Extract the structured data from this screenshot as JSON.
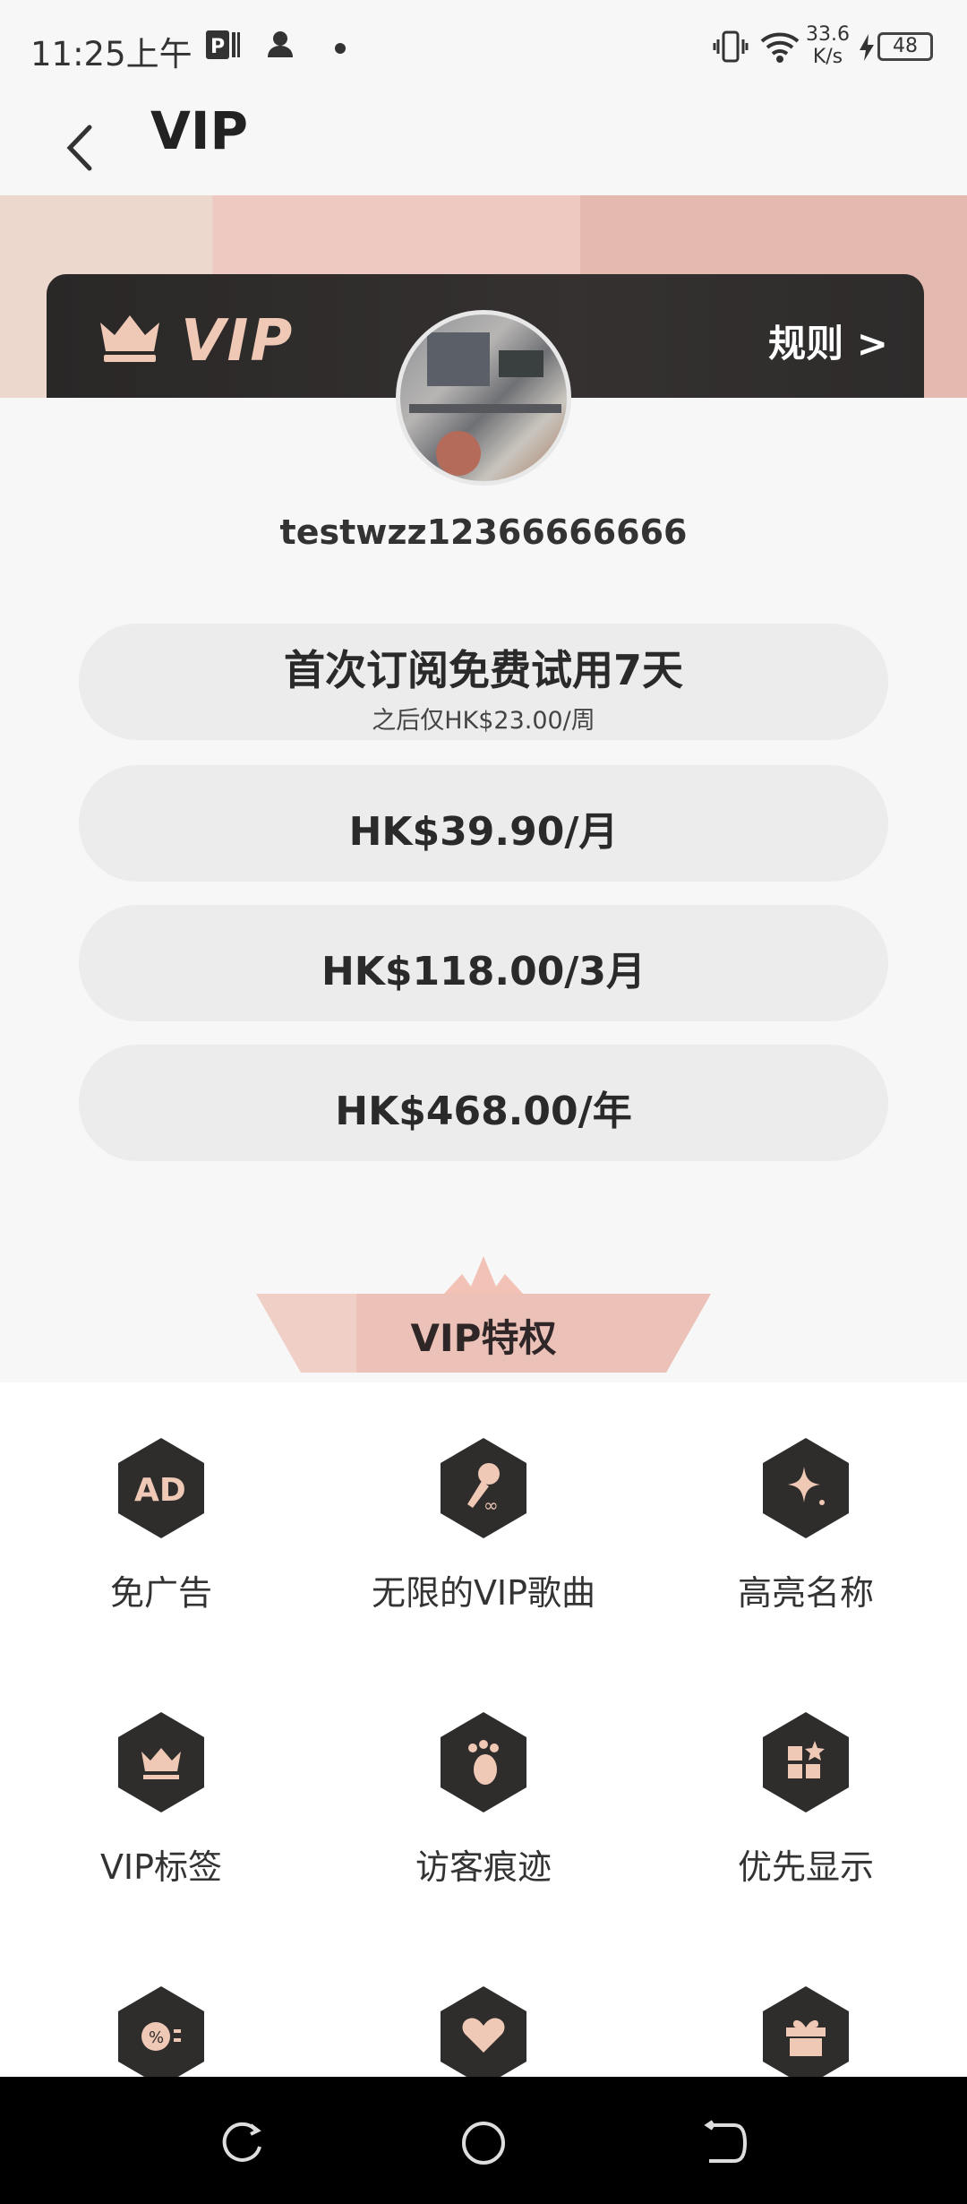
{
  "status_bar": {
    "time": "11:25上午",
    "net_speed_value": "33.6",
    "net_speed_unit": "K/s",
    "battery": "48"
  },
  "app_bar": {
    "title": "VIP"
  },
  "vip_banner": {
    "logo_text": "VIP",
    "rules_label": "规则 >"
  },
  "user": {
    "username": "testwzz12366666666"
  },
  "plans": [
    {
      "price": "首次订阅免费试用7天",
      "note": "之后仅HK$23.00/周"
    },
    {
      "price": "HK$39.90/月"
    },
    {
      "price": "HK$118.00/3月"
    },
    {
      "price": "HK$468.00/年"
    }
  ],
  "privileges": {
    "title": "VIP特权",
    "items": [
      {
        "label": "免广告",
        "icon": "ad-icon"
      },
      {
        "label": "无限的VIP歌曲",
        "icon": "microphone-icon"
      },
      {
        "label": "高亮名称",
        "icon": "sparkle-icon"
      },
      {
        "label": "VIP标签",
        "icon": "crown-icon"
      },
      {
        "label": "访客痕迹",
        "icon": "footprint-icon"
      },
      {
        "label": "优先显示",
        "icon": "grid-star-icon"
      },
      {
        "label": "",
        "icon": "discount-icon"
      },
      {
        "label": "",
        "icon": "heart-icon"
      },
      {
        "label": "",
        "icon": "gift-icon"
      }
    ]
  },
  "colors": {
    "accent_rose": "#edc9c1",
    "dark_banner": "#2a2727",
    "plan_bg": "#ececec",
    "icon_fill": "#f0c8b6"
  }
}
